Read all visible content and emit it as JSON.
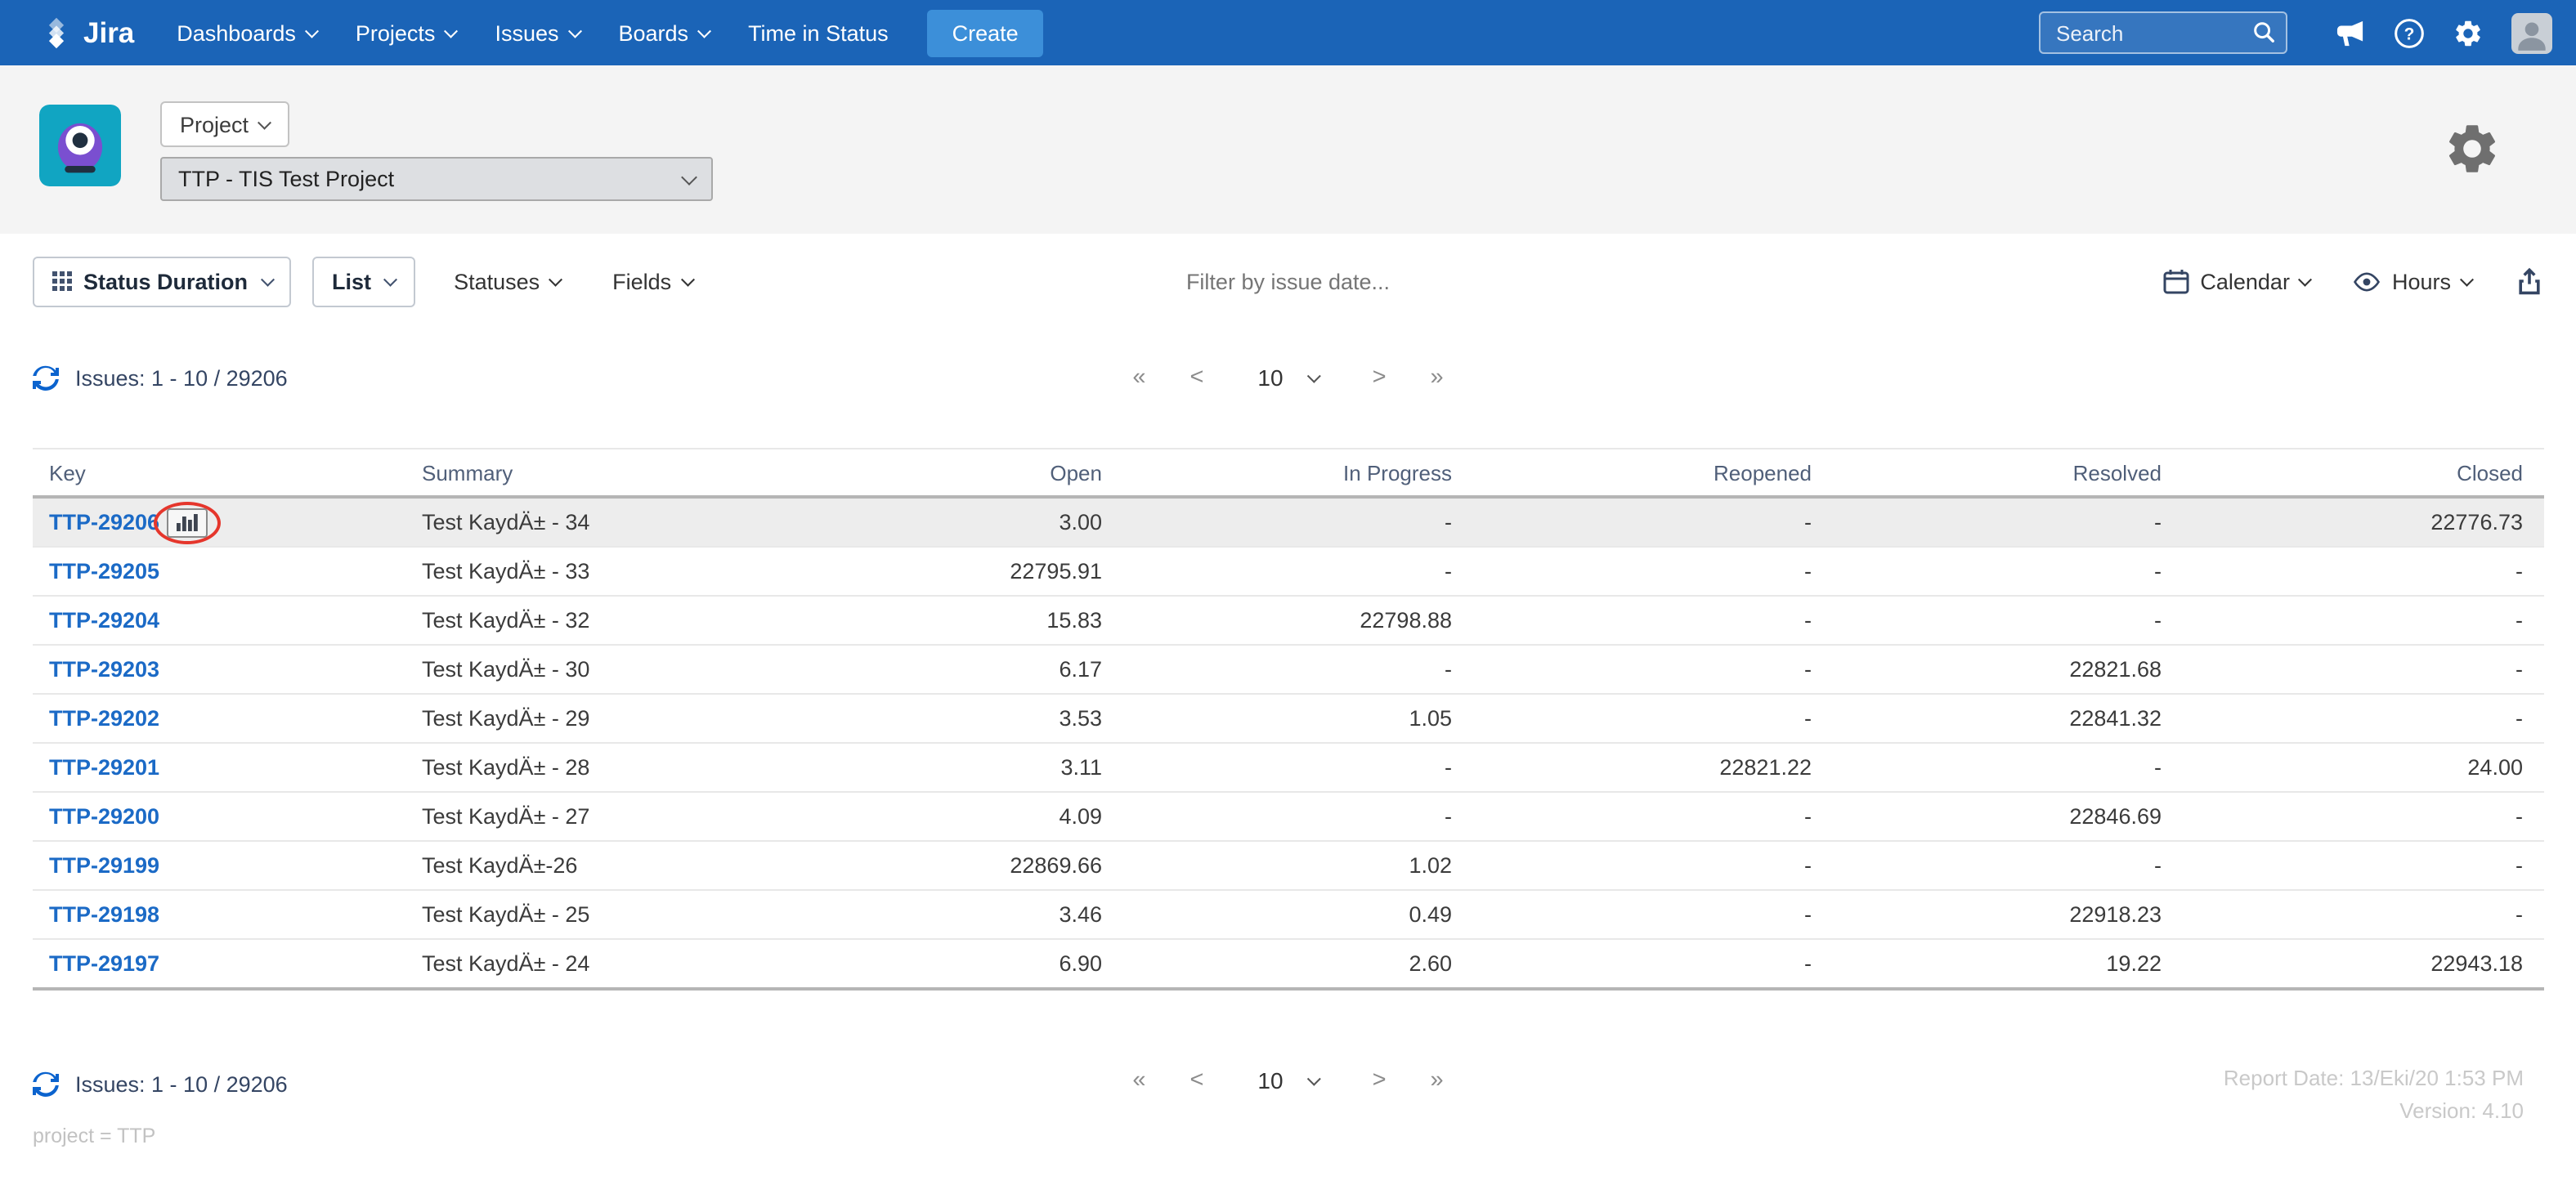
{
  "colors": {
    "navbar_bg": "#1b64b7",
    "create_button_bg": "#3c8fd9",
    "link_blue": "#1b6ac6",
    "refresh_blue": "#0b63ce",
    "highlight_ring_red": "#e5362c",
    "header_band_bg": "#f4f4f4",
    "highlighted_row_bg": "#ededed"
  },
  "navbar": {
    "brand": "Jira",
    "items": [
      {
        "label": "Dashboards"
      },
      {
        "label": "Projects"
      },
      {
        "label": "Issues"
      },
      {
        "label": "Boards"
      },
      {
        "label": "Time in Status"
      }
    ],
    "create_label": "Create",
    "search_placeholder": "Search"
  },
  "header": {
    "project_button": "Project",
    "project_select": "TTP - TIS Test Project"
  },
  "toolbar": {
    "report_type": "Status Duration",
    "view": "List",
    "statuses": "Statuses",
    "fields": "Fields",
    "filter_placeholder": "Filter by issue date...",
    "calendar": "Calendar",
    "hours": "Hours"
  },
  "pagination": {
    "issues_label": "Issues: 1 - 10 / 29206",
    "first": "«",
    "prev": "<",
    "page_size": "10",
    "next": ">",
    "last": "»"
  },
  "table": {
    "columns": [
      "Key",
      "Summary",
      "Open",
      "In Progress",
      "Reopened",
      "Resolved",
      "Closed"
    ],
    "rows": [
      {
        "key": "TTP-29206",
        "summary": "Test KaydÄ± - 34",
        "open": "3.00",
        "in_progress": "-",
        "reopened": "-",
        "resolved": "-",
        "closed": "22776.73",
        "highlighted": true,
        "chart_icon": true
      },
      {
        "key": "TTP-29205",
        "summary": "Test KaydÄ± - 33",
        "open": "22795.91",
        "in_progress": "-",
        "reopened": "-",
        "resolved": "-",
        "closed": "-"
      },
      {
        "key": "TTP-29204",
        "summary": "Test KaydÄ± - 32",
        "open": "15.83",
        "in_progress": "22798.88",
        "reopened": "-",
        "resolved": "-",
        "closed": "-"
      },
      {
        "key": "TTP-29203",
        "summary": "Test KaydÄ± - 30",
        "open": "6.17",
        "in_progress": "-",
        "reopened": "-",
        "resolved": "22821.68",
        "closed": "-"
      },
      {
        "key": "TTP-29202",
        "summary": "Test KaydÄ± - 29",
        "open": "3.53",
        "in_progress": "1.05",
        "reopened": "-",
        "resolved": "22841.32",
        "closed": "-"
      },
      {
        "key": "TTP-29201",
        "summary": "Test KaydÄ± - 28",
        "open": "3.11",
        "in_progress": "-",
        "reopened": "22821.22",
        "resolved": "-",
        "closed": "24.00"
      },
      {
        "key": "TTP-29200",
        "summary": "Test KaydÄ± - 27",
        "open": "4.09",
        "in_progress": "-",
        "reopened": "-",
        "resolved": "22846.69",
        "closed": "-"
      },
      {
        "key": "TTP-29199",
        "summary": "Test KaydÄ±-26",
        "open": "22869.66",
        "in_progress": "1.02",
        "reopened": "-",
        "resolved": "-",
        "closed": "-"
      },
      {
        "key": "TTP-29198",
        "summary": "Test KaydÄ± - 25",
        "open": "3.46",
        "in_progress": "0.49",
        "reopened": "-",
        "resolved": "22918.23",
        "closed": "-"
      },
      {
        "key": "TTP-29197",
        "summary": "Test KaydÄ± - 24",
        "open": "6.90",
        "in_progress": "2.60",
        "reopened": "-",
        "resolved": "19.22",
        "closed": "22943.18"
      }
    ]
  },
  "footer": {
    "issues_label": "Issues: 1 - 10 / 29206",
    "report_date": "Report Date: 13/Eki/20 1:53 PM",
    "version": "Version: 4.10",
    "query": "project = TTP"
  }
}
